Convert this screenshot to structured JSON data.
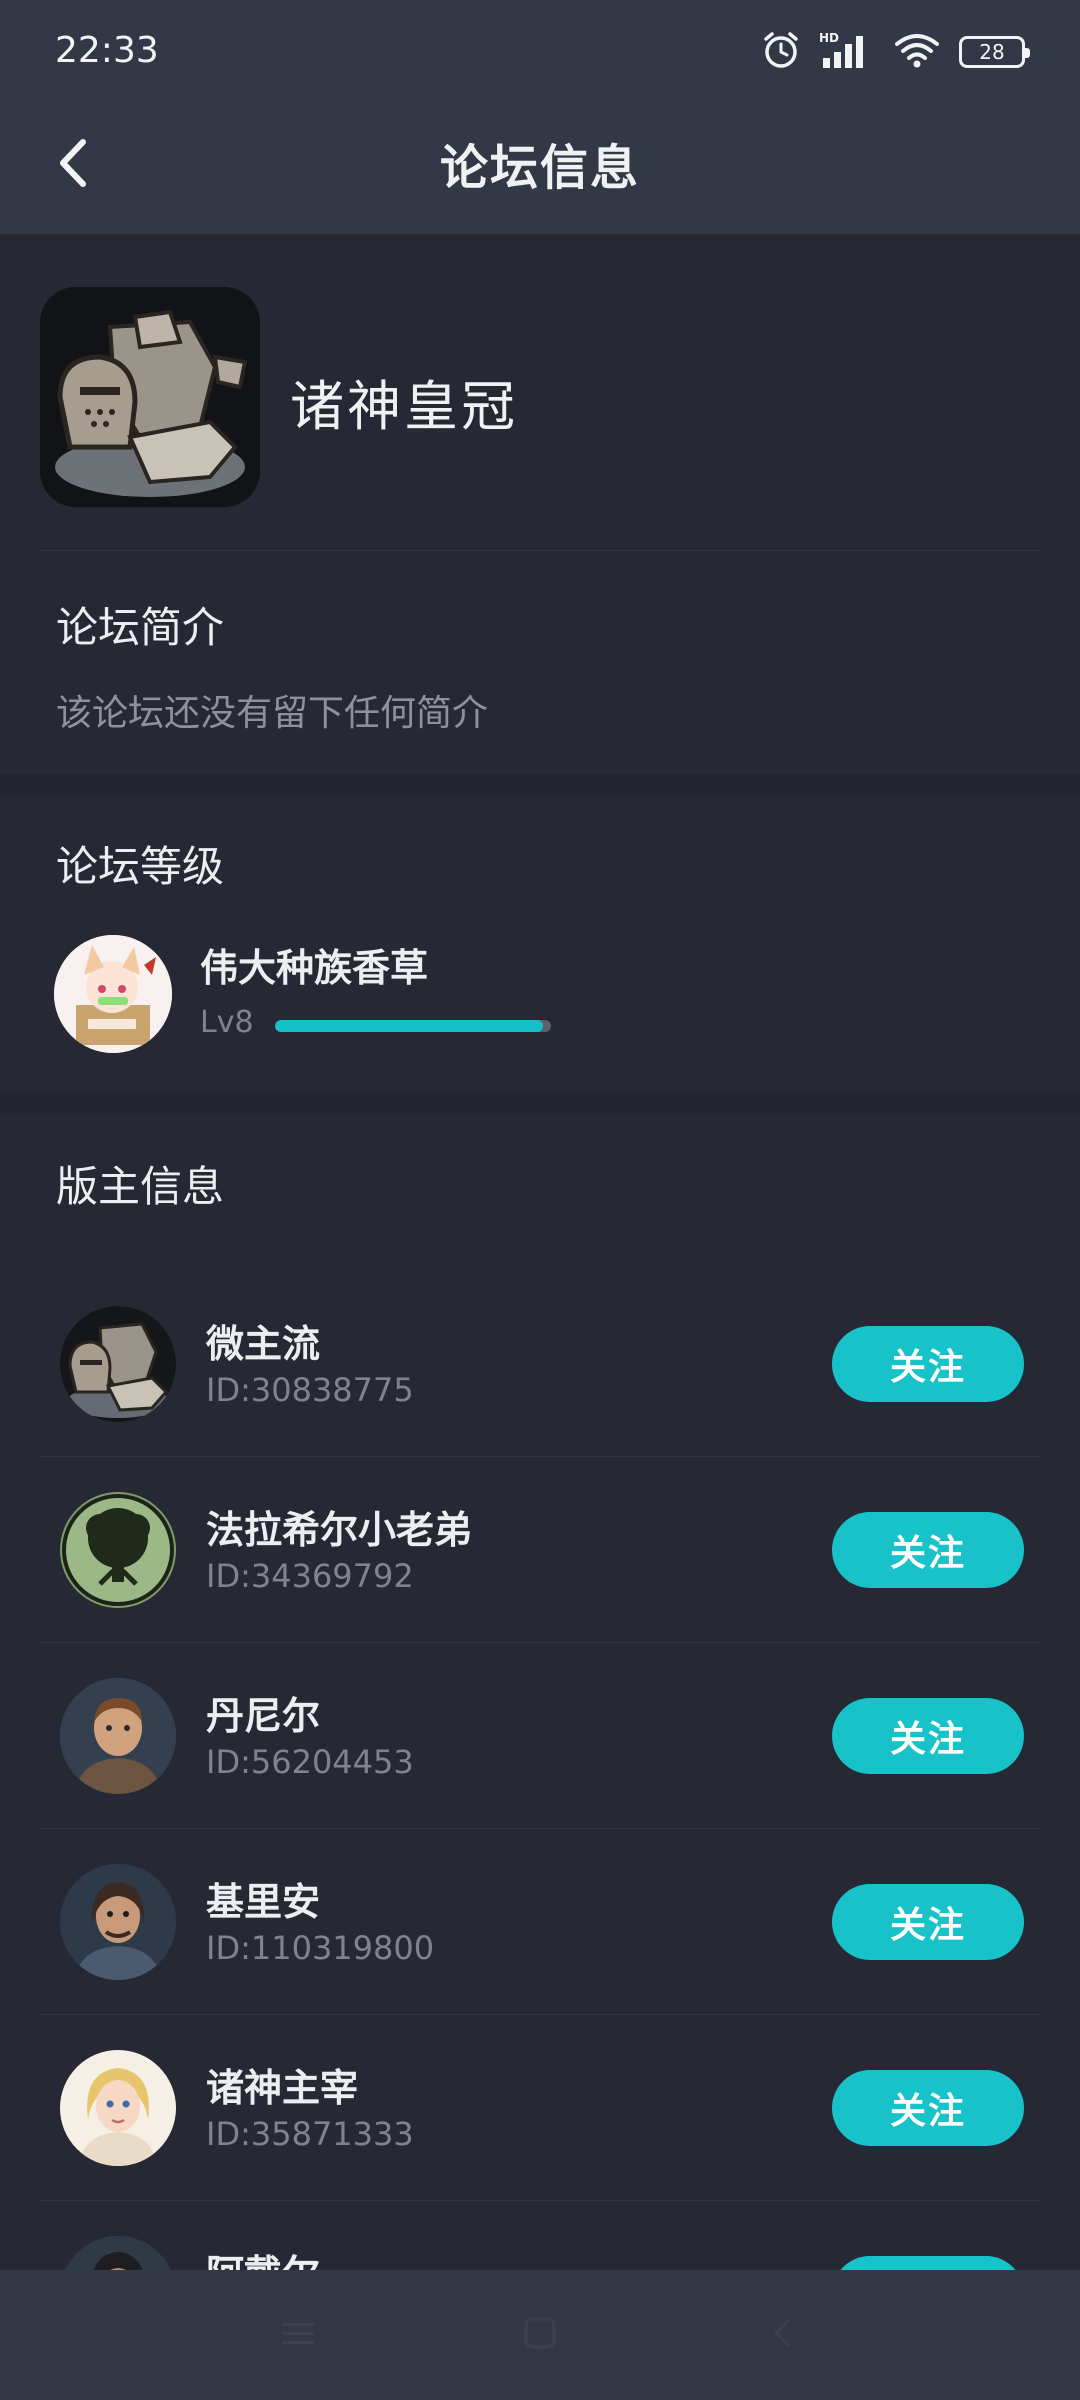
{
  "status_bar": {
    "time": "22:33",
    "battery": "28",
    "icons": [
      "alarm-icon",
      "hd-signal-icon",
      "wifi-icon",
      "battery-icon"
    ]
  },
  "header": {
    "title": "论坛信息",
    "back_icon": "chevron-left-icon"
  },
  "forum": {
    "name": "诸神皇冠",
    "intro_title": "论坛简介",
    "intro_text": "该论坛还没有留下任何简介"
  },
  "level": {
    "title": "论坛等级",
    "user_name": "伟大种族香草",
    "level_text": "Lv8",
    "progress": 0.97
  },
  "moderators": {
    "title": "版主信息",
    "follow_label": "关注",
    "items": [
      {
        "name": "微主流",
        "id": "ID:30838775"
      },
      {
        "name": "法拉希尔小老弟",
        "id": "ID:34369792"
      },
      {
        "name": "丹尼尔",
        "id": "ID:56204453"
      },
      {
        "name": "基里安",
        "id": "ID:110319800"
      },
      {
        "name": "诸神主宰",
        "id": "ID:35871333"
      },
      {
        "name": "阿戴尔",
        "id": ""
      }
    ]
  },
  "colors": {
    "accent": "#17c2c9",
    "background": "#22252f",
    "card": "#262934",
    "bar": "#333846"
  },
  "nav": {
    "icons": [
      "menu-icon",
      "home-square-icon",
      "back-triangle-icon"
    ]
  }
}
